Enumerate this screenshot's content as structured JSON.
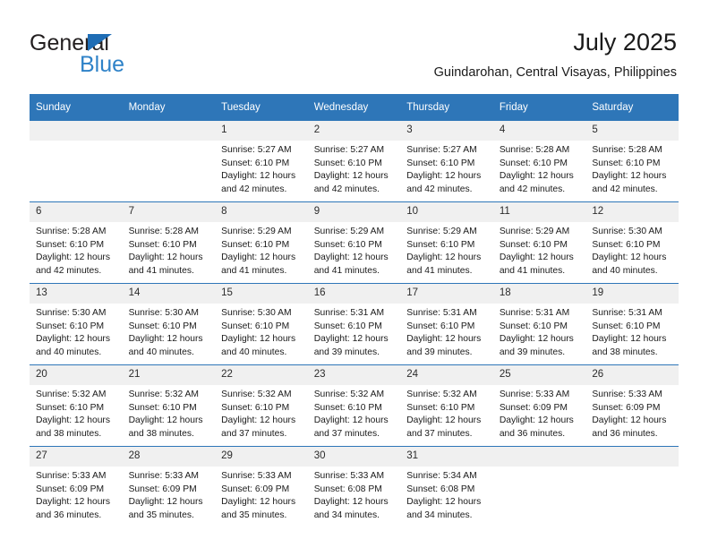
{
  "brand": {
    "name_part1": "General",
    "name_part2": "Blue",
    "accent_color": "#2e82c8",
    "triangle_color": "#1f6db5"
  },
  "header": {
    "title": "July 2025",
    "subtitle": "Guindarohan, Central Visayas, Philippines"
  },
  "calendar": {
    "header_bg": "#2e76b8",
    "daycell_bg": "#f0f0f0",
    "weekday_headers": [
      "Sunday",
      "Monday",
      "Tuesday",
      "Wednesday",
      "Thursday",
      "Friday",
      "Saturday"
    ],
    "weeks": [
      [
        {
          "day": "",
          "sunrise": "",
          "sunset": "",
          "daylight": "",
          "empty": true
        },
        {
          "day": "",
          "sunrise": "",
          "sunset": "",
          "daylight": "",
          "empty": true
        },
        {
          "day": "1",
          "sunrise": "Sunrise: 5:27 AM",
          "sunset": "Sunset: 6:10 PM",
          "daylight": "Daylight: 12 hours and 42 minutes."
        },
        {
          "day": "2",
          "sunrise": "Sunrise: 5:27 AM",
          "sunset": "Sunset: 6:10 PM",
          "daylight": "Daylight: 12 hours and 42 minutes."
        },
        {
          "day": "3",
          "sunrise": "Sunrise: 5:27 AM",
          "sunset": "Sunset: 6:10 PM",
          "daylight": "Daylight: 12 hours and 42 minutes."
        },
        {
          "day": "4",
          "sunrise": "Sunrise: 5:28 AM",
          "sunset": "Sunset: 6:10 PM",
          "daylight": "Daylight: 12 hours and 42 minutes."
        },
        {
          "day": "5",
          "sunrise": "Sunrise: 5:28 AM",
          "sunset": "Sunset: 6:10 PM",
          "daylight": "Daylight: 12 hours and 42 minutes."
        }
      ],
      [
        {
          "day": "6",
          "sunrise": "Sunrise: 5:28 AM",
          "sunset": "Sunset: 6:10 PM",
          "daylight": "Daylight: 12 hours and 42 minutes."
        },
        {
          "day": "7",
          "sunrise": "Sunrise: 5:28 AM",
          "sunset": "Sunset: 6:10 PM",
          "daylight": "Daylight: 12 hours and 41 minutes."
        },
        {
          "day": "8",
          "sunrise": "Sunrise: 5:29 AM",
          "sunset": "Sunset: 6:10 PM",
          "daylight": "Daylight: 12 hours and 41 minutes."
        },
        {
          "day": "9",
          "sunrise": "Sunrise: 5:29 AM",
          "sunset": "Sunset: 6:10 PM",
          "daylight": "Daylight: 12 hours and 41 minutes."
        },
        {
          "day": "10",
          "sunrise": "Sunrise: 5:29 AM",
          "sunset": "Sunset: 6:10 PM",
          "daylight": "Daylight: 12 hours and 41 minutes."
        },
        {
          "day": "11",
          "sunrise": "Sunrise: 5:29 AM",
          "sunset": "Sunset: 6:10 PM",
          "daylight": "Daylight: 12 hours and 41 minutes."
        },
        {
          "day": "12",
          "sunrise": "Sunrise: 5:30 AM",
          "sunset": "Sunset: 6:10 PM",
          "daylight": "Daylight: 12 hours and 40 minutes."
        }
      ],
      [
        {
          "day": "13",
          "sunrise": "Sunrise: 5:30 AM",
          "sunset": "Sunset: 6:10 PM",
          "daylight": "Daylight: 12 hours and 40 minutes."
        },
        {
          "day": "14",
          "sunrise": "Sunrise: 5:30 AM",
          "sunset": "Sunset: 6:10 PM",
          "daylight": "Daylight: 12 hours and 40 minutes."
        },
        {
          "day": "15",
          "sunrise": "Sunrise: 5:30 AM",
          "sunset": "Sunset: 6:10 PM",
          "daylight": "Daylight: 12 hours and 40 minutes."
        },
        {
          "day": "16",
          "sunrise": "Sunrise: 5:31 AM",
          "sunset": "Sunset: 6:10 PM",
          "daylight": "Daylight: 12 hours and 39 minutes."
        },
        {
          "day": "17",
          "sunrise": "Sunrise: 5:31 AM",
          "sunset": "Sunset: 6:10 PM",
          "daylight": "Daylight: 12 hours and 39 minutes."
        },
        {
          "day": "18",
          "sunrise": "Sunrise: 5:31 AM",
          "sunset": "Sunset: 6:10 PM",
          "daylight": "Daylight: 12 hours and 39 minutes."
        },
        {
          "day": "19",
          "sunrise": "Sunrise: 5:31 AM",
          "sunset": "Sunset: 6:10 PM",
          "daylight": "Daylight: 12 hours and 38 minutes."
        }
      ],
      [
        {
          "day": "20",
          "sunrise": "Sunrise: 5:32 AM",
          "sunset": "Sunset: 6:10 PM",
          "daylight": "Daylight: 12 hours and 38 minutes."
        },
        {
          "day": "21",
          "sunrise": "Sunrise: 5:32 AM",
          "sunset": "Sunset: 6:10 PM",
          "daylight": "Daylight: 12 hours and 38 minutes."
        },
        {
          "day": "22",
          "sunrise": "Sunrise: 5:32 AM",
          "sunset": "Sunset: 6:10 PM",
          "daylight": "Daylight: 12 hours and 37 minutes."
        },
        {
          "day": "23",
          "sunrise": "Sunrise: 5:32 AM",
          "sunset": "Sunset: 6:10 PM",
          "daylight": "Daylight: 12 hours and 37 minutes."
        },
        {
          "day": "24",
          "sunrise": "Sunrise: 5:32 AM",
          "sunset": "Sunset: 6:10 PM",
          "daylight": "Daylight: 12 hours and 37 minutes."
        },
        {
          "day": "25",
          "sunrise": "Sunrise: 5:33 AM",
          "sunset": "Sunset: 6:09 PM",
          "daylight": "Daylight: 12 hours and 36 minutes."
        },
        {
          "day": "26",
          "sunrise": "Sunrise: 5:33 AM",
          "sunset": "Sunset: 6:09 PM",
          "daylight": "Daylight: 12 hours and 36 minutes."
        }
      ],
      [
        {
          "day": "27",
          "sunrise": "Sunrise: 5:33 AM",
          "sunset": "Sunset: 6:09 PM",
          "daylight": "Daylight: 12 hours and 36 minutes."
        },
        {
          "day": "28",
          "sunrise": "Sunrise: 5:33 AM",
          "sunset": "Sunset: 6:09 PM",
          "daylight": "Daylight: 12 hours and 35 minutes."
        },
        {
          "day": "29",
          "sunrise": "Sunrise: 5:33 AM",
          "sunset": "Sunset: 6:09 PM",
          "daylight": "Daylight: 12 hours and 35 minutes."
        },
        {
          "day": "30",
          "sunrise": "Sunrise: 5:33 AM",
          "sunset": "Sunset: 6:08 PM",
          "daylight": "Daylight: 12 hours and 34 minutes."
        },
        {
          "day": "31",
          "sunrise": "Sunrise: 5:34 AM",
          "sunset": "Sunset: 6:08 PM",
          "daylight": "Daylight: 12 hours and 34 minutes."
        },
        {
          "day": "",
          "sunrise": "",
          "sunset": "",
          "daylight": "",
          "empty": true
        },
        {
          "day": "",
          "sunrise": "",
          "sunset": "",
          "daylight": "",
          "empty": true
        }
      ]
    ]
  }
}
